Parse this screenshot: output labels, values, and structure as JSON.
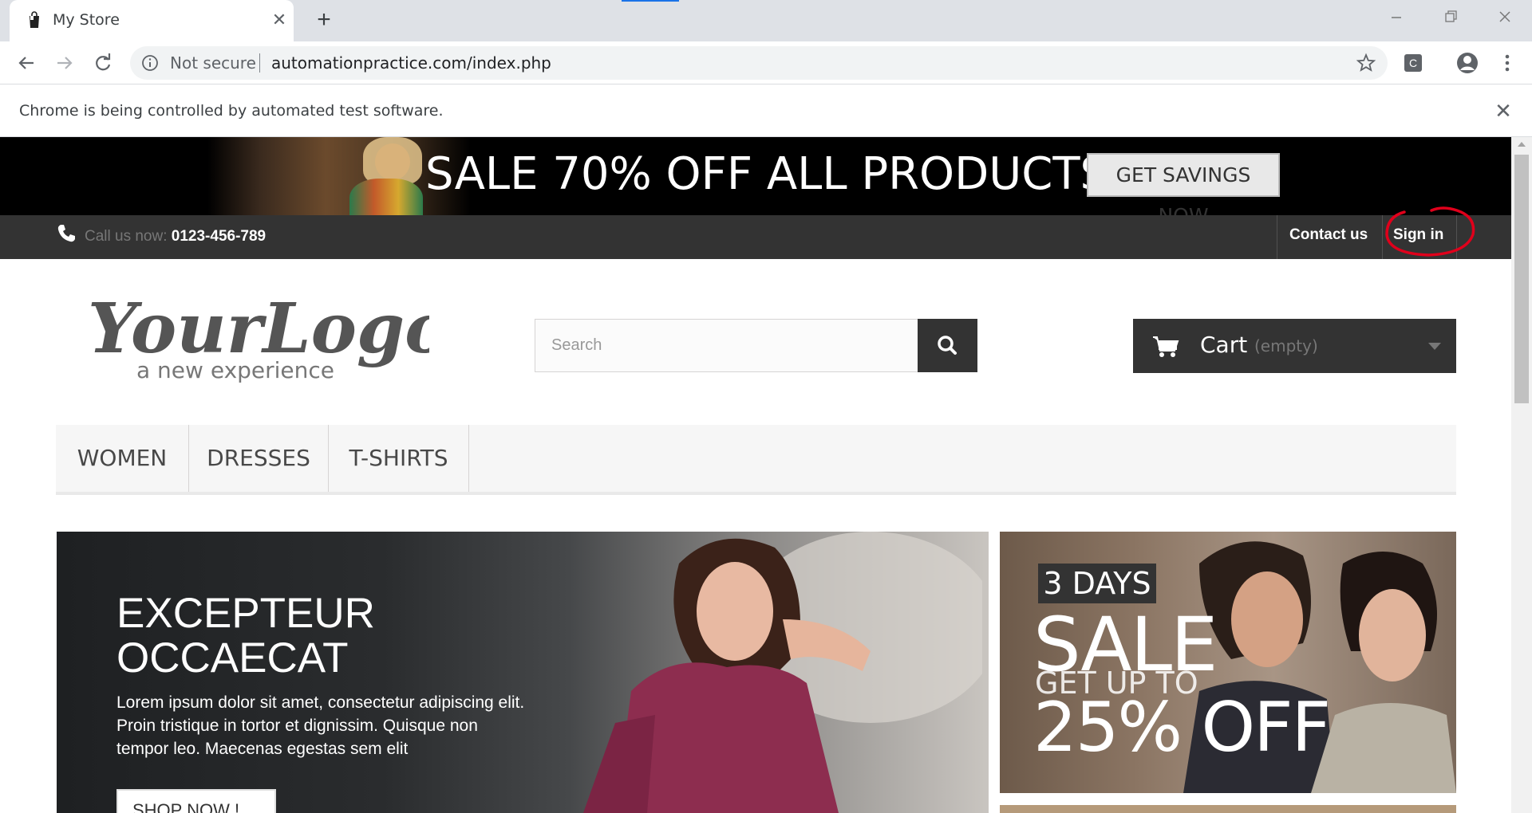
{
  "browser": {
    "tab_title": "My Store",
    "tab_close": "✕",
    "new_tab": "+",
    "security_label": "Not secure",
    "url": "automationpractice.com/index.php",
    "extension_letter": "C",
    "infobar_text": "Chrome is being controlled by automated test software.",
    "infobar_close": "✕"
  },
  "promo": {
    "headline": "SALE 70% OFF ALL PRODUCTS",
    "button": "GET SAVINGS NOW"
  },
  "header": {
    "call_label": "Call us now:",
    "phone": "0123-456-789",
    "contact": "Contact us",
    "signin": "Sign in"
  },
  "logo": {
    "main": "YourLogo",
    "tagline": "a new experience"
  },
  "search": {
    "placeholder": "Search"
  },
  "cart": {
    "label": "Cart",
    "status": "(empty)"
  },
  "menu": {
    "items": [
      "WOMEN",
      "DRESSES",
      "T-SHIRTS"
    ]
  },
  "slider": {
    "title_line1": "EXCEPTEUR",
    "title_line2": "OCCAECAT",
    "description": "Lorem ipsum dolor sit amet, consectetur adipiscing elit. Proin tristique in tortor et dignissim. Quisque non tempor leo. Maecenas egestas sem elit",
    "button": "SHOP NOW !"
  },
  "side_banner": {
    "days": "3 DAYS",
    "sale": "SALE",
    "get_up_to": "GET UP TO",
    "off": "25% OFF"
  },
  "colors": {
    "accent_annotation": "#e0001b",
    "header_bg": "#333333",
    "chrome_tabstrip": "#dee1e6"
  }
}
